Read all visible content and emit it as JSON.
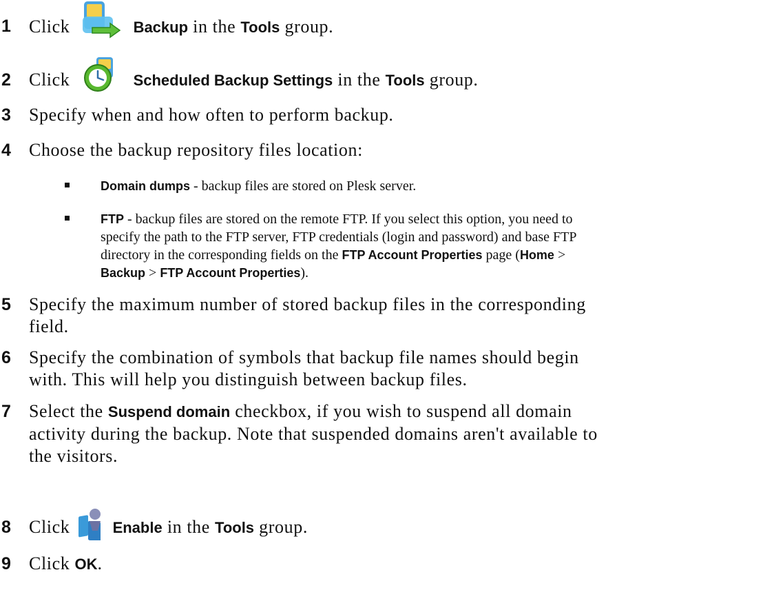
{
  "steps": [
    {
      "num": "1",
      "pre": "Click",
      "bold": "Backup",
      "mid": "in the",
      "bold2": "Tools",
      "post": "group.",
      "icon": "backup-icon"
    },
    {
      "num": "2",
      "pre": "Click",
      "bold": "Scheduled Backup Settings",
      "mid": "in the",
      "bold2": "Tools",
      "post": "group.",
      "icon": "scheduled-backup-icon"
    },
    {
      "num": "3",
      "text": "Specify when and how often to perform backup."
    },
    {
      "num": "4",
      "text": "Choose the backup repository files location:"
    },
    {
      "num": "5",
      "line1": "Specify the maximum number of stored backup files in the corresponding",
      "line2": "field."
    },
    {
      "num": "6",
      "line1": "Specify the combination of symbols that backup file names should begin",
      "line2": "with. This will help you distinguish between backup files."
    },
    {
      "num": "7",
      "pre": "Select the",
      "bold": "Suspend domain",
      "post1": "checkbox, if you wish to suspend all domain",
      "line2": "activity during the backup. Note that suspended domains aren't available to",
      "line3": "the visitors."
    },
    {
      "num": "8",
      "pre": "Click",
      "bold": "Enable",
      "mid": "in the",
      "bold2": "Tools",
      "post": "group.",
      "icon": "enable-icon"
    },
    {
      "num": "9",
      "pre": "Click",
      "bold": "OK",
      "post": "."
    }
  ],
  "bullets": [
    {
      "bold": "Domain dumps",
      "text": " - backup files are stored on Plesk server."
    },
    {
      "bold": "FTP",
      "line1": " - backup files are stored on the remote FTP.  If you select this option, you need to",
      "line2": "specify the path to the FTP server, FTP credentials (login and password) and base FTP",
      "line3_pre": "directory in the corresponding fields on the ",
      "line3_bold": "FTP Account Properties",
      "line3_mid": " page (",
      "line3_bold2": "Home",
      "line3_post": " >",
      "line4_bold1": "Backup",
      "line4_sep1": " > ",
      "line4_bold2": "FTP Account Properties",
      "line4_post": ")."
    }
  ]
}
